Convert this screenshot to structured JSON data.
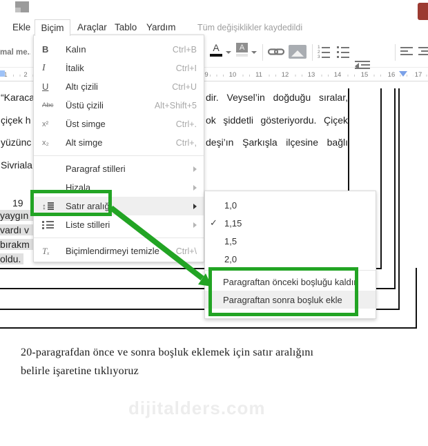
{
  "app": {
    "saved_status": "Tüm değişiklikler kaydedildi",
    "menubar": {
      "items": [
        "Ekle",
        "Biçim",
        "Araçlar",
        "Tablo",
        "Yardım"
      ],
      "active": "Biçim"
    },
    "toolbar": {
      "style_dropdown_value": "mal me...",
      "icons": [
        "text-color",
        "highlight-color",
        "insert-link",
        "insert-image",
        "numbered-list",
        "bulleted-list",
        "decrease-indent",
        "increase-indent",
        "align-left",
        "align-center",
        "align-right"
      ],
      "text_color_glyph": "A",
      "highlight_glyph": "A"
    },
    "ruler": {
      "numbers": [
        "1",
        "2",
        "9",
        "10",
        "11",
        "12",
        "13",
        "14",
        "15",
        "16",
        "17"
      ]
    }
  },
  "format_menu": {
    "items": [
      {
        "icon": "bold-icon",
        "glyph": "B",
        "label": "Kalın",
        "shortcut": "Ctrl+B"
      },
      {
        "icon": "italic-icon",
        "glyph": "I",
        "label": "İtalik",
        "shortcut": "Ctrl+I"
      },
      {
        "icon": "underline-icon",
        "glyph": "U",
        "label": "Altı çizili",
        "shortcut": "Ctrl+U"
      },
      {
        "icon": "strikethrough-icon",
        "glyph": "Abc",
        "label": "Üstü çizili",
        "shortcut": "Alt+Shift+5"
      },
      {
        "icon": "superscript-icon",
        "glyph": "x²",
        "label": "Üst simge",
        "shortcut": "Ctrl+."
      },
      {
        "icon": "subscript-icon",
        "glyph": "x₂",
        "label": "Alt simge",
        "shortcut": "Ctrl+,"
      },
      {
        "icon": "",
        "glyph": "",
        "label": "Paragraf stilleri",
        "shortcut": ""
      },
      {
        "icon": "",
        "glyph": "",
        "label": "Hizala",
        "shortcut": ""
      },
      {
        "icon": "line-spacing-icon",
        "glyph": "↕",
        "label": "Satır aralığı",
        "shortcut": ""
      },
      {
        "icon": "list-styles-icon",
        "glyph": "",
        "label": "Liste stilleri",
        "shortcut": ""
      },
      {
        "icon": "clear-formatting-icon",
        "glyph": "Tₓ",
        "label": "Biçimlendirmeyi temizle",
        "shortcut": "Ctrl+\\"
      }
    ]
  },
  "spacing_submenu": {
    "check_glyph": "✓",
    "options": [
      {
        "label": "1,0",
        "checked": false
      },
      {
        "label": "1,15",
        "checked": true
      },
      {
        "label": "1,5",
        "checked": false
      },
      {
        "label": "2,0",
        "checked": false
      }
    ],
    "actions": [
      {
        "label": "Paragraftan önceki boşluğu kaldır"
      },
      {
        "label": "Paragraftan sonra boşluk ekle"
      }
    ]
  },
  "document": {
    "left_column_lines": [
      "“Karaca",
      "çiçek h",
      "yüzünc",
      "Sivriala"
    ],
    "right_column_lines": [
      "dir. Veysel’in doğduğu sıralar,",
      "ok şiddetli gösteriyordu. Çiçek",
      "deşi’ın Şarkışla ilçesine bağlı"
    ],
    "paragraph2_first": "19",
    "paragraph2_selected_lines": [
      "yaygın",
      "vardı v",
      "bırakm",
      "oldu."
    ],
    "watermark": "dijitalders.com"
  },
  "caption": {
    "line1": "20-paragrafdan önce ve sonra boşluk eklemek için satır aralığını",
    "line2": "belirle işaretine tıklıyoruz"
  },
  "annotations": {
    "highlight_color": "#22a424"
  }
}
